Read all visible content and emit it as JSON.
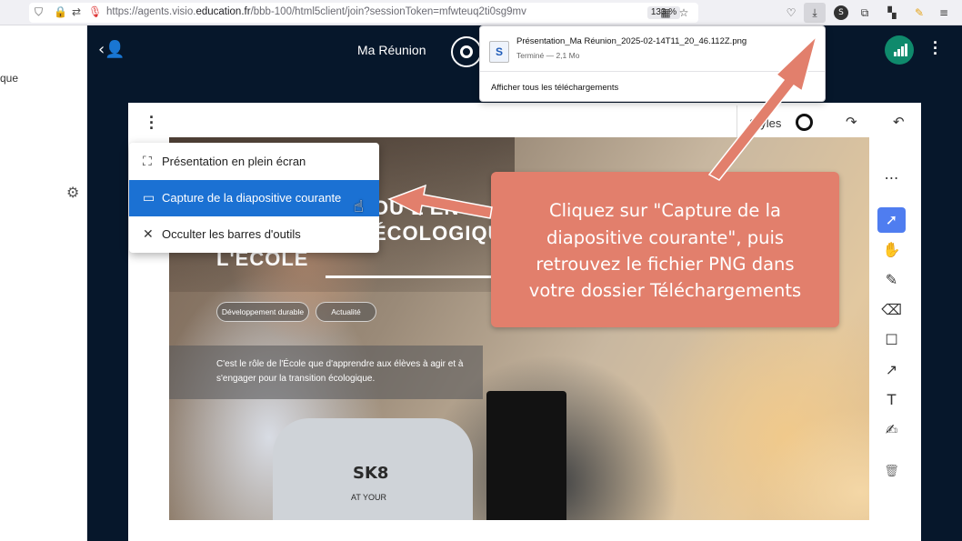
{
  "browser": {
    "url_prefix": "https://agents.visio.",
    "url_domain": "education.fr",
    "url_suffix": "/bbb-100/html5client/join?sessionToken=mfwteuq2ti0sg9mv",
    "zoom": "133 %"
  },
  "download_panel": {
    "file_name": "Présentation_Ma Réunion_2025-02-14T11_20_46.112Z.png",
    "status": "Terminé — 2,1 Mo",
    "show_all": "Afficher tous les téléchargements"
  },
  "left_panel": {
    "partial_text": "que"
  },
  "app": {
    "meeting_title": "Ma Réunion"
  },
  "whiteboard": {
    "styles_label": "Styles"
  },
  "context_menu": {
    "items": [
      {
        "label": "Présentation en plein écran",
        "icon": "fullscreen-icon"
      },
      {
        "label": "Capture de la diapositive courante",
        "icon": "camera-icon"
      },
      {
        "label": "Occulter les barres d'outils",
        "icon": "close-icon"
      }
    ]
  },
  "slide": {
    "title_line1": "OU L'EN",
    "title_line2": "ÉCOLOGIQUE",
    "title_line3": "L'ÉCOLE",
    "tags": [
      "Développement durable",
      "Actualité"
    ],
    "text_line1": "C'est le rôle de l'École que d'apprendre aux élèves à agir et à",
    "text_line2": "s'engager pour la transition écologique.",
    "shirt_text": "SK8",
    "shirt_subtext": "AT YOUR"
  },
  "tools": [
    "more-icon",
    "select-icon",
    "hand-icon",
    "pencil-icon",
    "eraser-icon",
    "rectangle-icon",
    "arrow-icon",
    "text-icon",
    "note-icon",
    "delete-icon"
  ],
  "callout": {
    "line1": "Cliquez sur \"Capture de la",
    "line2": "diapositive courante\", puis",
    "line3": "retrouvez le fichier PNG dans",
    "line4": "votre dossier Téléchargements"
  },
  "colors": {
    "callout": "#e27f6c",
    "accent": "#1b71d3",
    "app_bg": "#06172b"
  }
}
